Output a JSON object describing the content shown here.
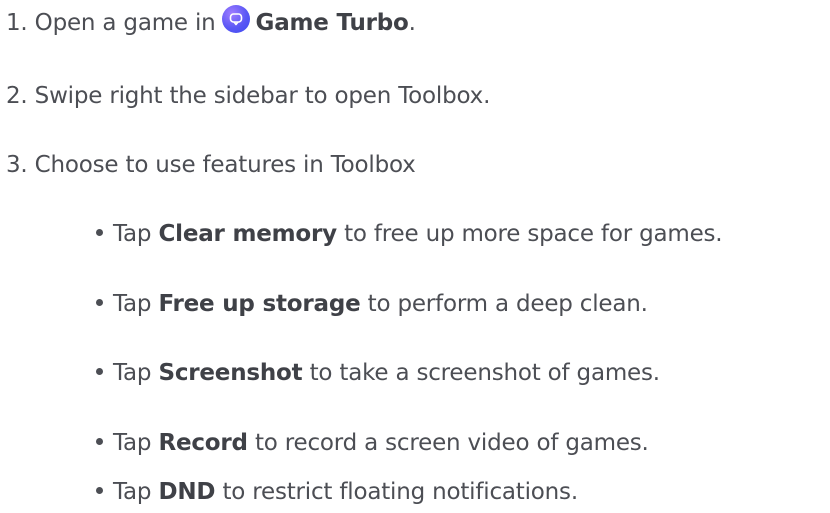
{
  "steps": [
    {
      "number": "1.",
      "before": "Open a game in",
      "icon": "game-turbo-icon",
      "strong": "Game Turbo",
      "after": "."
    },
    {
      "number": "2.",
      "text": "Swipe right the sidebar to open Toolbox."
    },
    {
      "number": "3.",
      "text": "Choose to use features in Toolbox"
    }
  ],
  "bullets": [
    {
      "prefix": "Tap",
      "strong": "Clear memory",
      "rest": "to free up more space for games."
    },
    {
      "prefix": "Tap",
      "strong": "Free up storage",
      "rest": "to perform a deep clean."
    },
    {
      "prefix": "Tap",
      "strong": "Screenshot",
      "rest": "to take a screenshot of games."
    },
    {
      "prefix": "Tap",
      "strong": "Record",
      "rest": "to record a screen video of games."
    },
    {
      "prefix": "Tap",
      "strong": "DND",
      "rest": "to restrict floating notifications."
    }
  ],
  "colors": {
    "text": "#4c4e54",
    "icon_gradient_start": "#9f7cff",
    "icon_gradient_end": "#3b4af0"
  }
}
